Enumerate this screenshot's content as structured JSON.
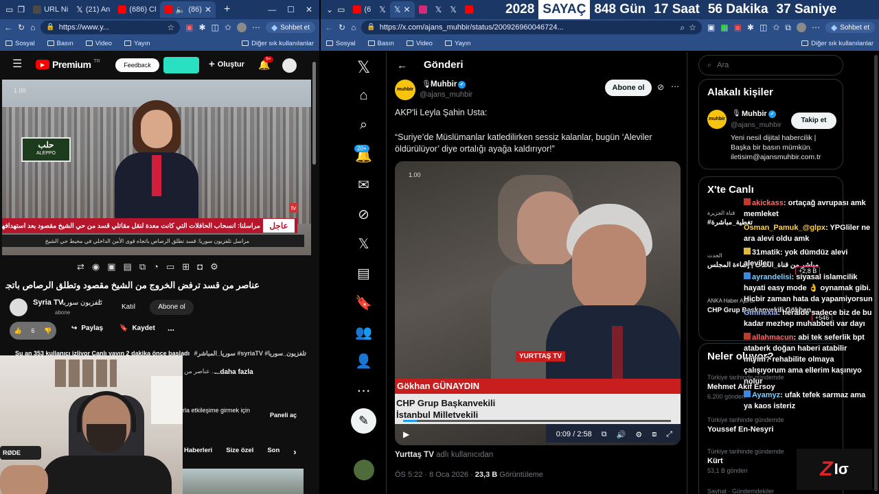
{
  "left_window": {
    "tabs": [
      {
        "label": "URL Ni",
        "color": "#4a4a4a"
      },
      {
        "label": "(21) An",
        "color": "#111111"
      },
      {
        "label": "(686) Cl",
        "color": "#ff0000"
      },
      {
        "label": "(86)",
        "color": "#ff0000"
      }
    ],
    "address": "https://www.y...",
    "copilot_label": "Sohbet et",
    "bookmarks": [
      "Sosyal",
      "Basın",
      "Video",
      "Yayın"
    ],
    "other_bookmarks": "Diğer sık kullanılanlar"
  },
  "youtube": {
    "logo_text": "Premium",
    "logo_region": "TR",
    "feedback_text": "Feedback",
    "create_label": "Oluştur",
    "notif_badge": "9+",
    "video_speed": "1.00",
    "breaking_label": "عاجل",
    "ticker_main": "مراسلنا: انسحاب الحافلات التي كانت معدة لنقل مقاتلي قسد من حي الشيخ مقصود بعد استهدافها من قسد",
    "ticker_sub": "مراسل تلفزيون سوريا: قسد تطلق الرصاص باتجاه قوى الأمن الداخلي في محيط حي الشيخ",
    "city_sign": "حلب",
    "city_sign_latin": "ALEPPO",
    "channel_watermark": "tv",
    "title": "عناصر من قسد ترفض الخروج من الشيخ مقصود وتطلق الرصاص باتجاه قوى الأمن",
    "channel_name": "Syria TV",
    "channel_name_ar": "تلفزيون سوريا",
    "subscriber_text": "abone",
    "join_label": "Katıl",
    "subscribe_label": "Abone ol",
    "like_count": "6",
    "share_label": "Paylaş",
    "save_label": "Kaydet",
    "more_label": "...",
    "live_info": "Şu an 353 kullanıcı izliyor  Canlı yayın 2 dakika önce başladı",
    "hashtags": "#سوريا_المباشر #syriaTV #تلفزيون_سوريا",
    "description_snippet": "عناصر من ...",
    "more_text": "...daha fazla",
    "chat_hint": "rla etkileşime girmek için",
    "chat_panel_label": "Paneli aç",
    "chips": [
      "Haberleri",
      "Size özel",
      "Son"
    ]
  },
  "right_window": {
    "tab_count_label": "(6",
    "address": "https://x.com/ajans_muhbir/status/200926960046724...",
    "copilot_label": "Sohbet et",
    "bookmarks": [
      "Sosyal",
      "Basın",
      "Video",
      "Yayın"
    ],
    "other_bookmarks": "Diğer sık kullanılanlar"
  },
  "counter": {
    "year": "2028",
    "label": "SAYAÇ",
    "days": "848 Gün",
    "hours": "17 Saat",
    "minutes": "56 Dakika",
    "seconds": "37 Saniye"
  },
  "x": {
    "header_title": "Gönderi",
    "notif_badge": "20+",
    "author_name": "Muhbir",
    "author_handle": "@ajans_muhbir",
    "subscribe_label": "Abone ol",
    "avatar_text": "muhbir",
    "post_line1": "AKP'li Leyla Şahin Usta:",
    "post_line2": "“Suriye’de Müslümanlar katledilirken sessiz kalanlar, bugün ‘Aleviler öldürülüyor’ diye ortalığı ayağa kaldırıyor!”",
    "video_speed": "1.00",
    "video_logo": "YURTTAŞ TV",
    "lower_third_name": "Gökhan GÜNAYDIN",
    "lower_third_title1": "CHP Grup Başkanvekili",
    "lower_third_title2": "İstanbul Milletvekili",
    "video_time": "0:09 / 2:58",
    "source_name": "Yurttaş TV",
    "source_suffix": "adlı kullanıcıdan",
    "post_time": "ÖS 5:22 · 8 Oca 2026 ·",
    "views_count": "23,3 B",
    "views_label": "Görüntüleme",
    "search_placeholder": "Ara",
    "related_title": "Alakalı kişiler",
    "related_name": "Muhbir",
    "related_handle": "@ajans_muhbir",
    "follow_label": "Takip et",
    "related_bio": "Yeni nesil dijital habercilik | Başka bir basın mümkün. iletisim@ajansmuhbir.com.tr",
    "live_title": "X'te Canlı",
    "live_items": [
      {
        "name": "قناة الجزيرة",
        "text": "#تغطية_مباشرة"
      },
      {
        "name": "الحدث",
        "text": "مباشر من قناة_الحدث | إضاءة المجلس"
      },
      {
        "name": "ANKA Haber Ajansı",
        "text": "CHP Grup Başkanvekili Gökhan..."
      }
    ],
    "live_badges": [
      "+2,8 B",
      "+546"
    ],
    "trends_title": "Neler oluyor?",
    "trends": [
      {
        "context": "Türkiye tarihinde gündemde",
        "name": "Mehmet Akif Ersoy",
        "count": "6.200 gönderi"
      },
      {
        "context": "Türkiye tarihinde gündemde",
        "name": "Youssef En-Nesyri",
        "count": ""
      },
      {
        "context": "Türkiye tarihinde gündemde",
        "name": "Kürt",
        "count": "53,1 B gönderi"
      }
    ],
    "trend_more": "Sayhat · Gündemdekiler"
  },
  "chat_overlay": [
    {
      "user": "akickass",
      "color": "#ff6a6a",
      "msg": "ortaçağ avrupası amk memleket"
    },
    {
      "user": "Osman_Pamuk_@glpx",
      "color": "#ffd24a",
      "msg": "YPGliler ne ara alevi oldu amk"
    },
    {
      "user": "31matik",
      "color": "#ffffff",
      "msg": "yok dümdüz alevi aleviler"
    },
    {
      "user": "ayrandelisi",
      "color": "#7ad0ff",
      "msg": "siyasal islamcilik hayati easy mode 👌 oynamak gibi. Hicbir zaman hata da yapamiyorsun"
    },
    {
      "user": "Gimnexia",
      "color": "#9bb7ff",
      "msg": "heralde sadece biz de bu kadar mezhep muhabbeti var dayı"
    },
    {
      "user": "allahmacun",
      "color": "#ff6a6a",
      "msg": "abi tek seferlik bpt ataberk doğan haberi atabilir miyim? rehabilite olmaya çalışıyorum ama ellerim kaşınıyo nolur"
    },
    {
      "user": "Ayamyz",
      "color": "#7ad0ff",
      "msg": "ufak tefek sarmaz ama ya kaos isteriz"
    }
  ],
  "stream_logo": "Z",
  "colors": {
    "tab_bg": "#1a3766",
    "toolbar_bg": "#2b4e86",
    "x_blue": "#1d9bf0",
    "yt_red": "#ff0000"
  }
}
